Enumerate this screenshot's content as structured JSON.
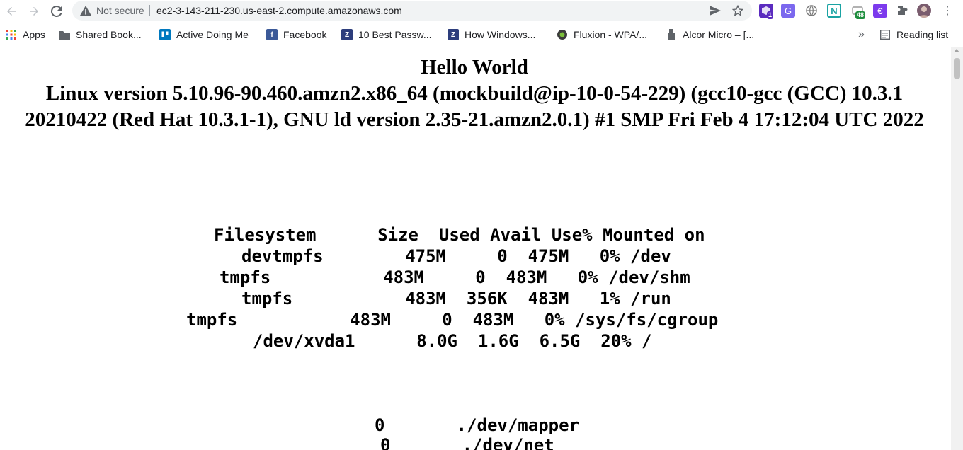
{
  "browser": {
    "security_label": "Not secure",
    "url": "ec2-3-143-211-230.us-east-2.compute.amazonaws.com",
    "extensions": [
      {
        "name": "extension-1",
        "badge": "1",
        "color": "#5b2bbf"
      },
      {
        "name": "translate",
        "color": "#7b68ee"
      },
      {
        "name": "globe",
        "color": "#6f6f6f"
      },
      {
        "name": "notion-clipper",
        "color": "#1aa3a3"
      },
      {
        "name": "tab-counter",
        "badge": "48",
        "color": "#1e8e3e"
      },
      {
        "name": "extension-e",
        "color": "#7c3aed"
      }
    ]
  },
  "bookmarks": {
    "items": [
      {
        "label": "Apps",
        "icon": "apps-grid-icon"
      },
      {
        "label": "Shared Book...",
        "icon": "folder-icon"
      },
      {
        "label": "Active Doing Me",
        "icon": "trello-icon"
      },
      {
        "label": "Facebook",
        "icon": "facebook-icon"
      },
      {
        "label": "10 Best Passw...",
        "icon": "bookmark-site-icon"
      },
      {
        "label": "How Windows...",
        "icon": "bookmark-site-icon"
      },
      {
        "label": "Fluxion - WPA/...",
        "icon": "fluxion-icon"
      },
      {
        "label": "Alcor Micro – [...",
        "icon": "usb-icon"
      }
    ],
    "overflow_label": "»",
    "reading_list_label": "Reading list"
  },
  "page": {
    "title": "Hello World",
    "kernel_version": "Linux version 5.10.96-90.460.amzn2.x86_64 (mockbuild@ip-10-0-54-229) (gcc10-gcc (GCC) 10.3.1 20210422 (Red Hat 10.3.1-1), GNU ld version 2.35-21.amzn2.0.1) #1 SMP Fri Feb 4 17:12:04 UTC 2022",
    "df_header": "Filesystem      Size  Used Avail Use% Mounted on",
    "df_rows": [
      "devtmpfs        475M     0  475M   0% /dev",
      "tmpfs           483M     0  483M   0% /dev/shm",
      "tmpfs           483M  356K  483M   1% /run",
      "tmpfs           483M     0  483M   0% /sys/fs/cgroup",
      "/dev/xvda1      8.0G  1.6G  6.5G  20% /"
    ],
    "du_rows": [
      "0\t./dev/mapper",
      "0\t./dev/net"
    ]
  }
}
